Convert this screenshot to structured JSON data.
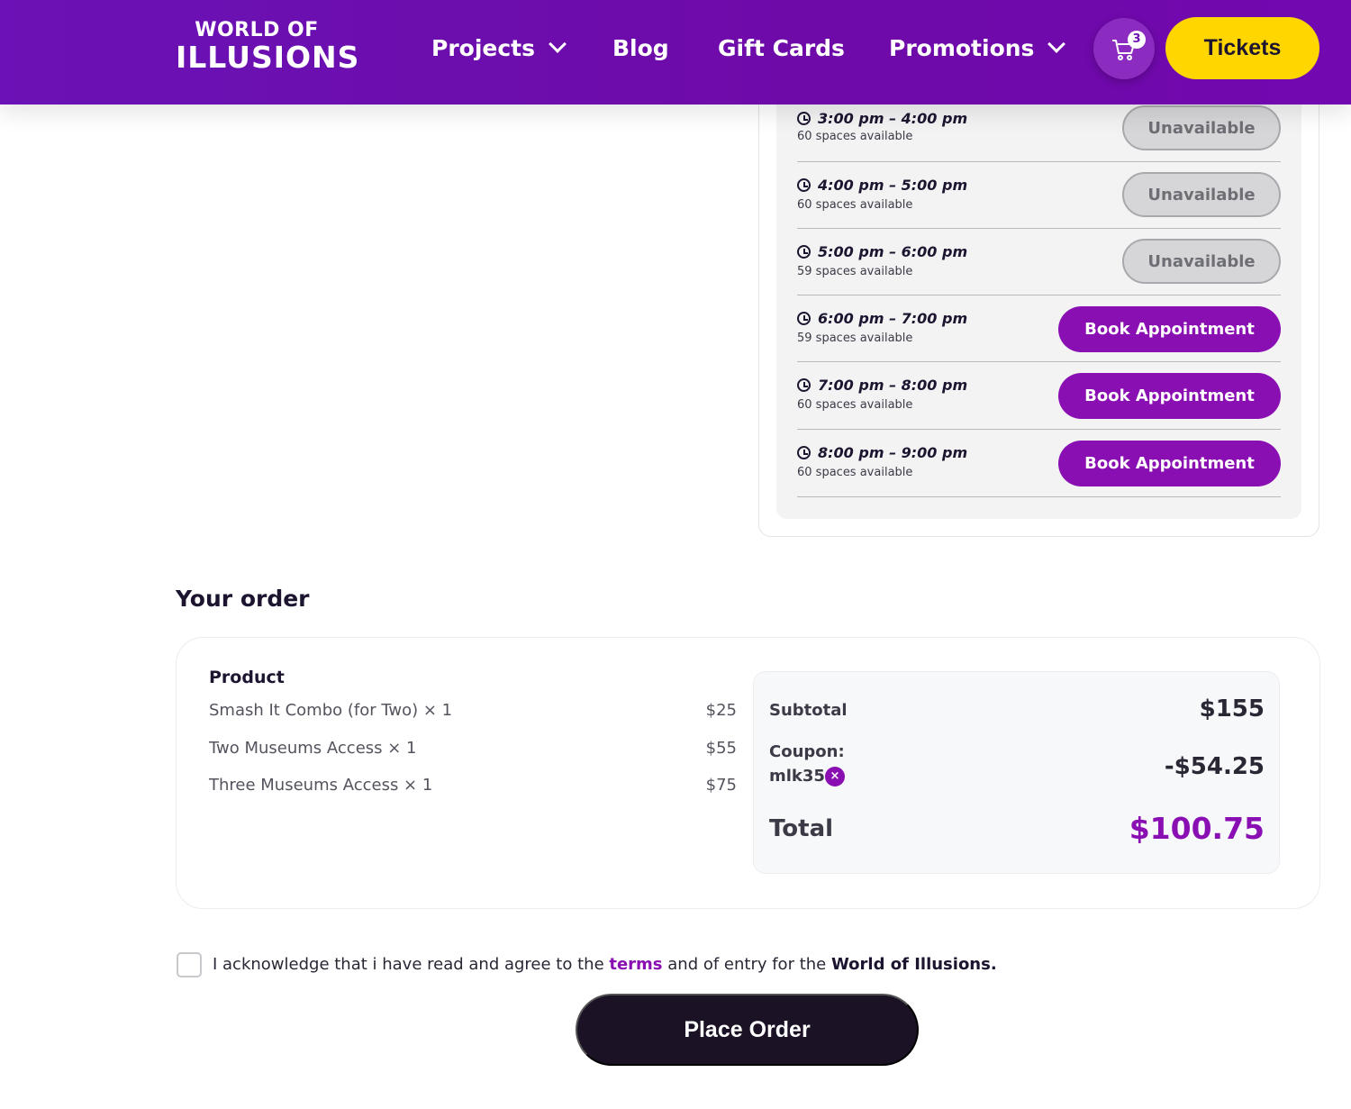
{
  "header": {
    "logo_top": "WORLD OF",
    "logo_bottom": "ILLUSIONS",
    "nav": {
      "projects": "Projects",
      "blog": "Blog",
      "gift_cards": "Gift Cards",
      "promotions": "Promotions"
    },
    "cart_count": "3",
    "tickets": "Tickets",
    "brand_color": "#6a12b5",
    "tickets_color": "#ffd600"
  },
  "slots": [
    {
      "time": "3:00 pm – 4:00 pm",
      "spaces": "60 spaces available",
      "button": "Unavailable",
      "available": false
    },
    {
      "time": "4:00 pm – 5:00 pm",
      "spaces": "60 spaces available",
      "button": "Unavailable",
      "available": false
    },
    {
      "time": "5:00 pm – 6:00 pm",
      "spaces": "59 spaces available",
      "button": "Unavailable",
      "available": false
    },
    {
      "time": "6:00 pm – 7:00 pm",
      "spaces": "59 spaces available",
      "button": "Book Appointment",
      "available": true
    },
    {
      "time": "7:00 pm – 8:00 pm",
      "spaces": "60 spaces available",
      "button": "Book Appointment",
      "available": true
    },
    {
      "time": "8:00 pm – 9:00 pm",
      "spaces": "60 spaces available",
      "button": "Book Appointment",
      "available": true
    }
  ],
  "order": {
    "title": "Your order",
    "product_header": "Product",
    "items": [
      {
        "name": "Smash It Combo (for Two) × 1",
        "price": "$25"
      },
      {
        "name": "Two Museums Access × 1",
        "price": "$55"
      },
      {
        "name": "Three Museums Access × 1",
        "price": "$75"
      }
    ],
    "subtotal_label": "Subtotal",
    "subtotal": "$155",
    "coupon_label": "Coupon:",
    "coupon_code": "mlk35",
    "coupon_remove": "×",
    "discount": "-$54.25",
    "total_label": "Total",
    "total": "$100.75"
  },
  "terms": {
    "prefix": "I acknowledge that i have read and agree to the ",
    "link": "terms",
    "middle": " and of entry for the ",
    "bold": "World of Illusions."
  },
  "place_order": "Place Order"
}
